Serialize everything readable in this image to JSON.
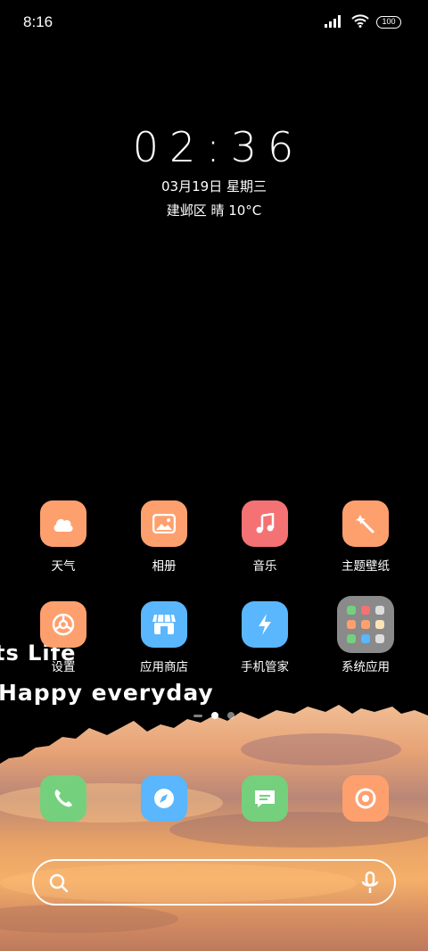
{
  "status_bar": {
    "time": "8:16",
    "battery": "100",
    "signal_icon": "signal-bars-icon",
    "wifi_icon": "wifi-icon"
  },
  "clock_widget": {
    "time": "02:36",
    "date": "03月19日 星期三",
    "weather": "建邺区 晴 10°C"
  },
  "apps": [
    {
      "label": "天气",
      "icon": "weather-icon",
      "color": "#fea06e"
    },
    {
      "label": "相册",
      "icon": "gallery-icon",
      "color": "#fea06e"
    },
    {
      "label": "音乐",
      "icon": "music-icon",
      "color": "#f47273"
    },
    {
      "label": "主题壁纸",
      "icon": "themes-icon",
      "color": "#fea06e"
    },
    {
      "label": "设置",
      "icon": "settings-icon",
      "color": "#fea06e"
    },
    {
      "label": "应用商店",
      "icon": "app-store-icon",
      "color": "#5ab6fd"
    },
    {
      "label": "手机管家",
      "icon": "security-icon",
      "color": "#5ab6fd"
    },
    {
      "label": "系统应用",
      "icon": "folder-icon",
      "color": "#8a8a8a"
    }
  ],
  "wallpaper_text": {
    "line1": "ts Life",
    "line2": "Happy everyday"
  },
  "dock": [
    {
      "icon": "phone-icon",
      "color": "#75d07d"
    },
    {
      "icon": "browser-icon",
      "color": "#5ab6fd"
    },
    {
      "icon": "messages-icon",
      "color": "#75d07d"
    },
    {
      "icon": "camera-icon",
      "color": "#fea06e"
    }
  ],
  "search_bar": {
    "search_icon": "search-icon",
    "mic_icon": "microphone-icon"
  }
}
